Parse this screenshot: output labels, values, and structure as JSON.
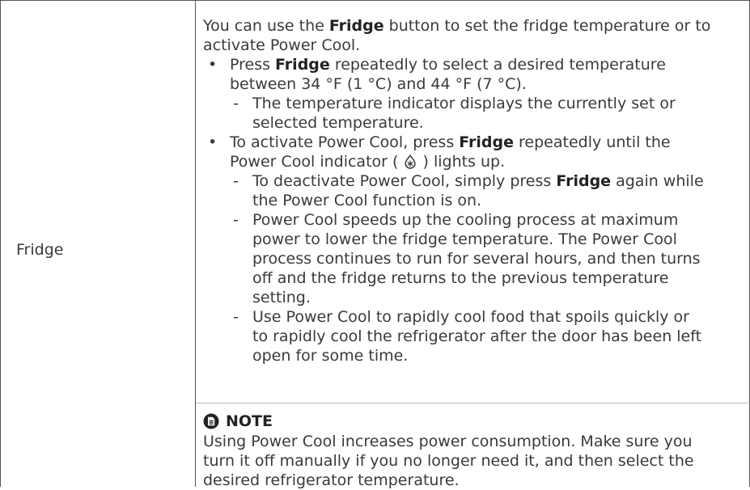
{
  "row_label": "Fridge",
  "intro": {
    "pre": "You can use the ",
    "bold": "Fridge",
    "post_line1": " button to set the fridge temperature or to",
    "line2": "activate Power Cool."
  },
  "bullet1": {
    "pre": "Press ",
    "bold": "Fridge",
    "post_line1": " repeatedly to select a desired temperature",
    "line2": "between 34 °F (1 °C) and 44 °F (7 °C).",
    "sub1_line1": "The temperature indicator displays the currently set or",
    "sub1_line2": "selected temperature."
  },
  "bullet2": {
    "pre": "To activate Power Cool, press ",
    "bold": "Fridge",
    "post_line1": " repeatedly until the",
    "line2_pre": "Power Cool indicator ( ",
    "line2_post": " ) lights up.",
    "sub1_pre": "To deactivate Power Cool, simply press ",
    "sub1_bold": "Fridge",
    "sub1_post": " again while",
    "sub1_line2": "the Power Cool function is on.",
    "sub2_lines": [
      "Power Cool speeds up the cooling process at maximum",
      "power to lower the fridge temperature. The Power Cool",
      "process continues to run for several hours, and then turns",
      "off and the fridge returns to the previous temperature",
      "setting."
    ],
    "sub3_lines": [
      "Use Power Cool to rapidly cool food that spoils quickly or",
      "to rapidly cool the refrigerator after the door has been left",
      "open for some time."
    ]
  },
  "note": {
    "heading": "NOTE",
    "lines": [
      "Using Power Cool increases power consumption. Make sure you",
      "turn it off manually if you no longer need it, and then select the",
      "desired refrigerator temperature."
    ]
  },
  "symbols": {
    "bullet": "•",
    "dash": "-"
  },
  "colors": {
    "text": "#3a3a3a",
    "border": "#555555"
  }
}
